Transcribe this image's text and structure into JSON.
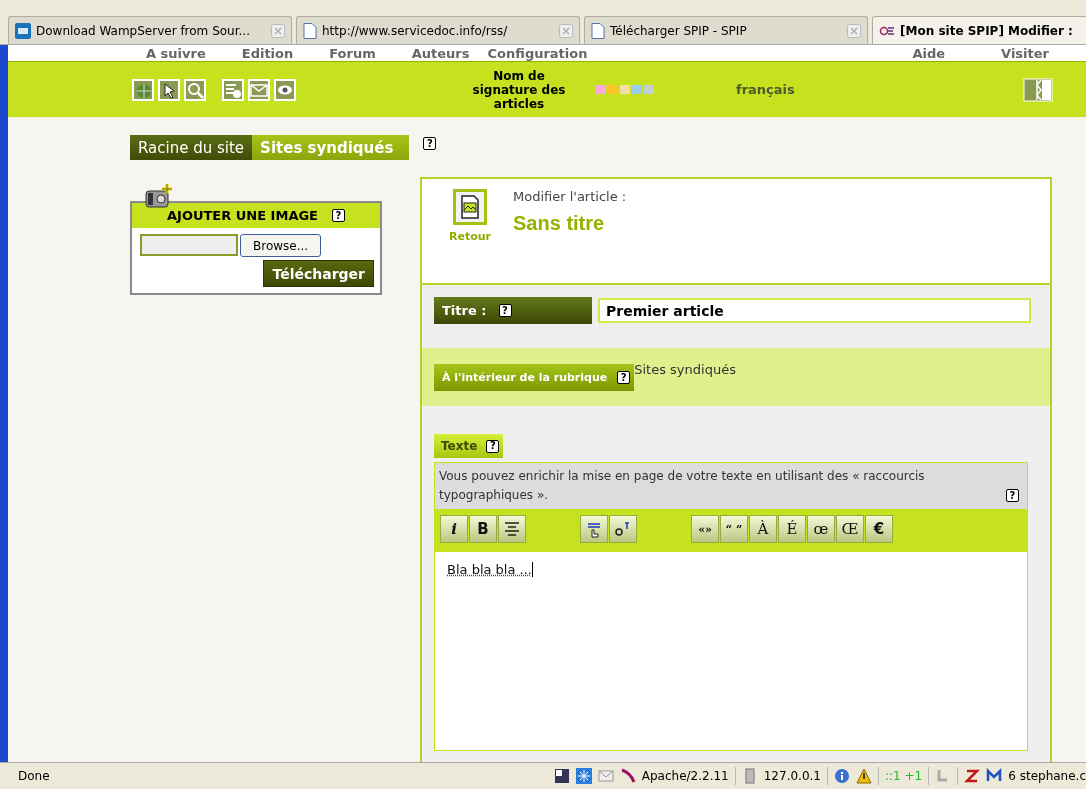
{
  "browser_tabs": [
    {
      "kind": "sf",
      "label": "Download WampServer from Sour...",
      "selected": false
    },
    {
      "kind": "page",
      "label": "http://www.servicedoc.info/rss/",
      "selected": false
    },
    {
      "kind": "page",
      "label": "Télécharger SPIP - SPIP",
      "selected": false
    },
    {
      "kind": "spip",
      "label": "[Mon site SPIP] Modifier :",
      "selected": true
    }
  ],
  "nav_menu": {
    "left": [
      "A suivre",
      "Edition",
      "Forum",
      "Auteurs",
      "Configuration"
    ],
    "right": [
      "Aide",
      "Visiter"
    ]
  },
  "toolbar": {
    "signature": "Nom de signature des articles",
    "swatches": [
      {
        "color": "#ffa8e0"
      },
      {
        "color": "#ffc22a"
      },
      {
        "color": "#f5dcaa"
      },
      {
        "color": "#99ccee"
      },
      {
        "color": "#c4ccd4"
      }
    ],
    "language": "français"
  },
  "breadcrumb": {
    "items": [
      {
        "label": "Racine du site",
        "selected": false
      },
      {
        "label": "Sites syndiqués",
        "selected": true
      }
    ],
    "help": "?"
  },
  "image_box": {
    "title": "AJOUTER UNE IMAGE",
    "help": "?",
    "browse": "Browse...",
    "upload": "Télécharger"
  },
  "editor": {
    "heading": "Modifier l'article :",
    "title": "Sans titre",
    "back": "Retour",
    "titre": {
      "label": "Titre :",
      "help": "?",
      "value": "Premier article"
    },
    "rubrique": {
      "label": "À l'intérieur de la rubrique",
      "help": "?",
      "value": "Sites syndiqués"
    },
    "texte": {
      "label": "Texte",
      "help": "?",
      "hint": "Vous pouvez enrichir la mise en page de votre texte en utilisant des « raccourcis typographiques ».",
      "hint_help": "?",
      "value": "Bla bla bla ..."
    },
    "format_buttons": [
      {
        "kind": "italic",
        "text": "i"
      },
      {
        "kind": "bold",
        "text": "B"
      },
      {
        "kind": "align"
      },
      {
        "kind": "gap"
      },
      {
        "kind": "link"
      },
      {
        "kind": "note"
      },
      {
        "kind": "gap"
      },
      {
        "kind": "quote",
        "text": "«»"
      },
      {
        "kind": "quote",
        "text": "“ ”"
      },
      {
        "kind": "letter",
        "text": "À"
      },
      {
        "kind": "letter",
        "text": "É"
      },
      {
        "kind": "letter",
        "text": "œ"
      },
      {
        "kind": "letter",
        "text": "Œ"
      },
      {
        "kind": "bold",
        "text": "€"
      }
    ]
  },
  "status_bar": {
    "status": "Done",
    "server": "Apache/2.2.11",
    "address": "127.0.0.1",
    "counter": "::1 +1",
    "mail": "6 stephane.c"
  }
}
